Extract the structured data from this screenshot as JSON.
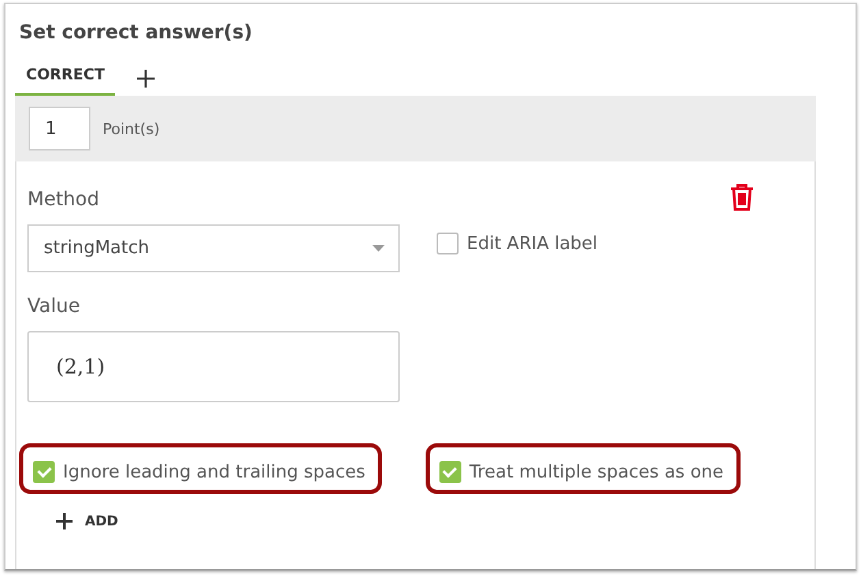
{
  "section_title": "Set correct answer(s)",
  "tabs": [
    {
      "label": "CORRECT",
      "selected": true
    }
  ],
  "points": {
    "value": "1",
    "label": "Point(s)"
  },
  "method": {
    "label": "Method",
    "value": "stringMatch"
  },
  "aria_option": {
    "label": "Edit ARIA label",
    "checked": false
  },
  "answer": {
    "label": "Value",
    "value": "(2,1)"
  },
  "options": [
    {
      "label": "Ignore leading and trailing spaces",
      "checked": true,
      "highlighted": true
    },
    {
      "label": "Treat multiple spaces as one",
      "checked": true,
      "highlighted": true
    }
  ],
  "add_button": {
    "label": "ADD"
  }
}
